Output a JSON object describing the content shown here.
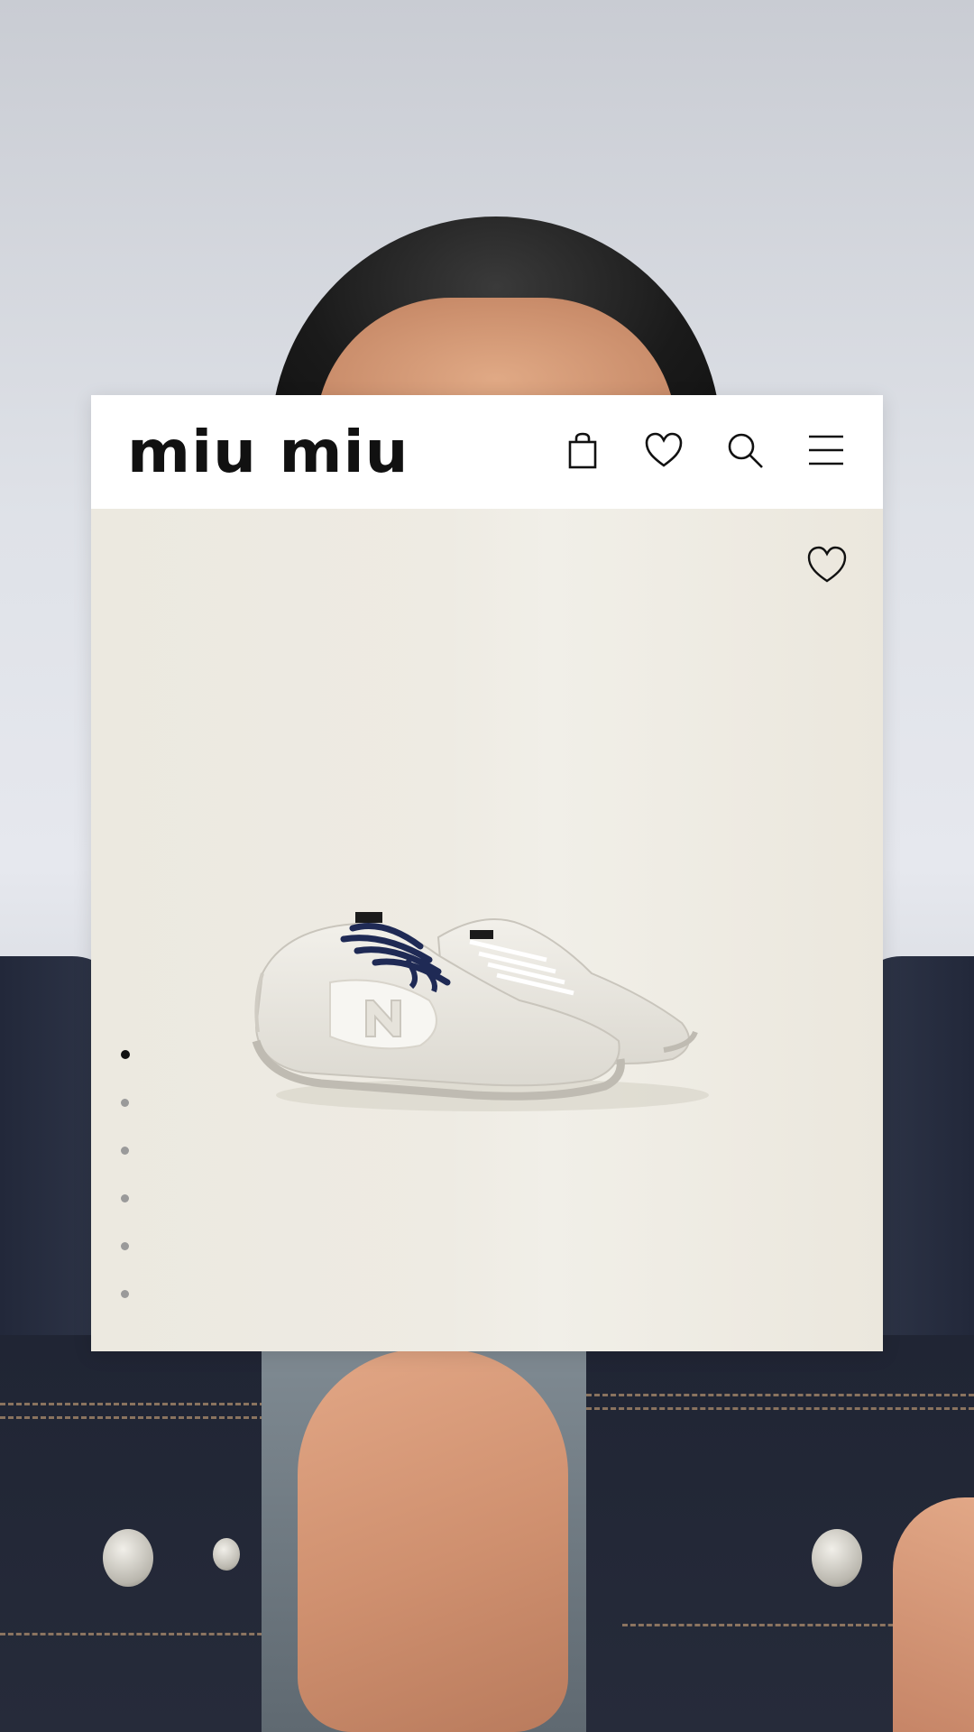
{
  "header": {
    "logo_text": "miu miu",
    "icons": [
      "shopping-bag-icon",
      "heart-icon",
      "search-icon",
      "menu-icon"
    ]
  },
  "product": {
    "wishlist_icon": "heart-icon",
    "gallery_count": 6,
    "gallery_active_index": 0
  },
  "colors": {
    "card_background": "#ffffff",
    "media_background": "#eeebe3",
    "icon_color": "#111111",
    "dot_active": "#111111",
    "dot_inactive": "#9a9a9a",
    "sneaker_laces": "#1f2a55"
  }
}
